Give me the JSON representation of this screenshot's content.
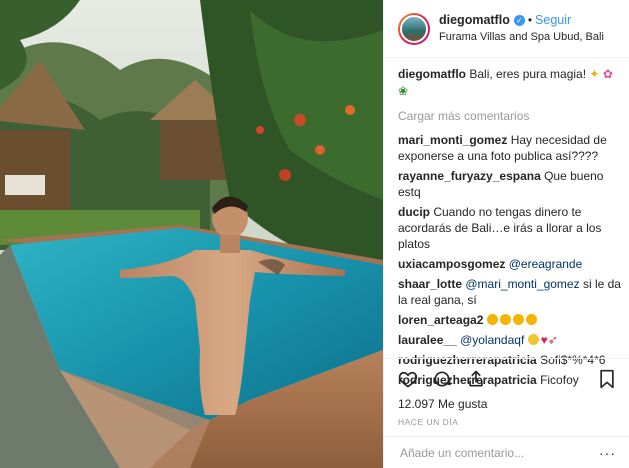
{
  "post": {
    "username": "diegomatflo",
    "follow_label": "Seguir",
    "separator": "•",
    "location": "Furama Villas and Spa Ubud, Bali",
    "caption_user": "diegomatflo",
    "caption_text": "Bali, eres pura magia!",
    "caption_emojis": [
      "sparkles-icon",
      "hibiscus-icon",
      "seedling-icon"
    ],
    "load_more_label": "Cargar más comentarios",
    "comments": [
      {
        "user": "mari_monti_gomez",
        "text": "Hay necesidad de exponerse a una foto publica así????"
      },
      {
        "user": "rayanne_furyazy_espana",
        "text": "Que bueno estq"
      },
      {
        "user": "ducip",
        "text": "Cuando no tengas dinero te acordarás de Bali…e irás a llorar a los platos"
      },
      {
        "user": "uxiacamposgomez",
        "mention": "@ereagrande",
        "text": ""
      },
      {
        "user": "shaar_lotte",
        "mention": "@mari_monti_gomez",
        "text": "si le da la real gana, sí"
      },
      {
        "user": "loren_arteaga2",
        "text": "",
        "emojis": [
          "heart-eyes-icon",
          "heart-eyes-icon",
          "heart-eyes-icon",
          "heart-eyes-icon"
        ]
      },
      {
        "user": "lauralee__",
        "mention": "@yolandaqf",
        "text": "",
        "emojis": [
          "smirk-icon",
          "red-heart-icon",
          "bow-arrow-icon"
        ]
      },
      {
        "user": "rodriguezherrerapatricia",
        "text": "Sofi$*%*4*6"
      },
      {
        "user": "rodriguezherrerapatricia",
        "text": "Ficofoy"
      }
    ],
    "likes": "12.097 Me gusta",
    "time_ago": "HACE UN DÍA",
    "add_comment_placeholder": "Añade un comentario...",
    "more_options": "···"
  },
  "colors": {
    "link_blue": "#3897f0",
    "mention": "#003569",
    "muted": "#999999",
    "border": "#efefef"
  }
}
